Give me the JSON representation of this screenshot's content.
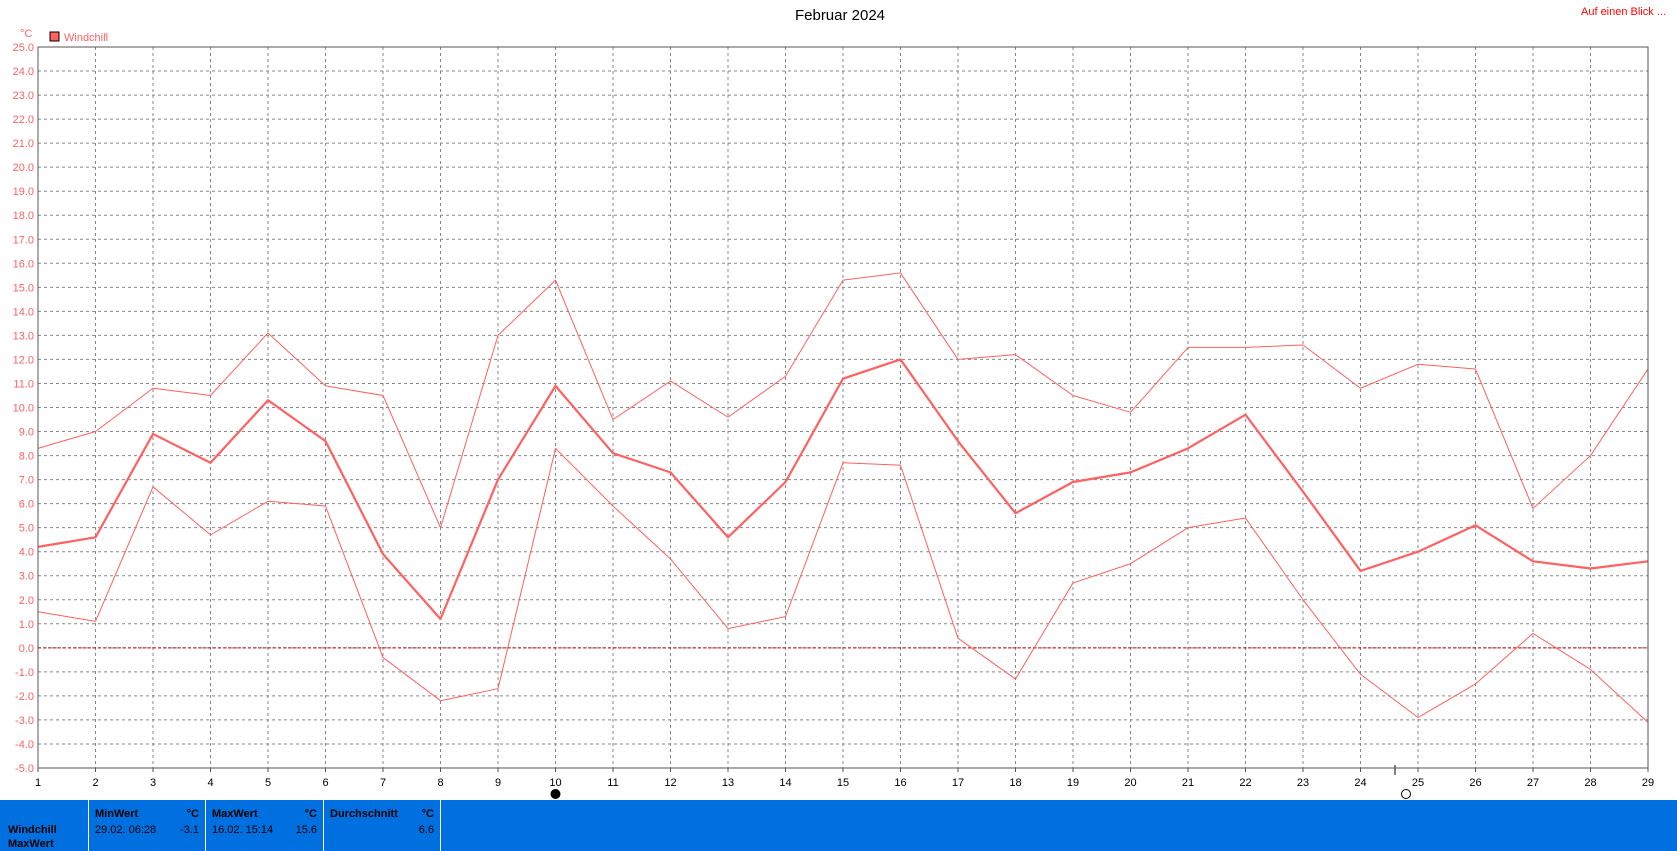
{
  "header": {
    "title": "Februar 2024",
    "link_label": "Auf einen Blick ..."
  },
  "colors": {
    "series": "#ff6060",
    "zero_line": "#cc0000",
    "footer_bg": "#0070e0"
  },
  "chart_data": {
    "type": "line",
    "title": "Februar 2024",
    "ylabel": "°C",
    "ylim": [
      -5,
      25
    ],
    "ytick_step": 1,
    "grid": true,
    "legend_placement": "top-left",
    "legend": [
      "Windchill"
    ],
    "x": [
      1,
      2,
      3,
      4,
      5,
      6,
      7,
      8,
      9,
      10,
      11,
      12,
      13,
      14,
      15,
      16,
      17,
      18,
      19,
      20,
      21,
      22,
      23,
      24,
      25,
      26,
      27,
      28,
      29
    ],
    "series": [
      {
        "name": "Windchill",
        "role": "avg",
        "values": [
          4.2,
          4.6,
          8.9,
          7.7,
          10.3,
          8.6,
          3.9,
          1.2,
          7.0,
          10.9,
          8.1,
          7.3,
          4.6,
          6.9,
          11.2,
          12.0,
          8.6,
          5.6,
          6.9,
          7.3,
          8.3,
          9.7,
          6.5,
          3.2,
          4.0,
          5.1,
          3.6,
          3.3,
          3.6
        ]
      },
      {
        "role": "max",
        "values": [
          8.3,
          9.0,
          10.8,
          10.5,
          13.1,
          10.9,
          10.5,
          5.0,
          13.0,
          15.3,
          9.5,
          11.1,
          9.6,
          11.3,
          15.3,
          15.6,
          12.0,
          12.2,
          10.5,
          9.8,
          12.5,
          12.5,
          12.6,
          10.8,
          11.8,
          11.6,
          5.8,
          8.0,
          11.6
        ]
      },
      {
        "role": "min",
        "values": [
          1.5,
          1.1,
          6.7,
          4.7,
          6.1,
          5.9,
          -0.4,
          -2.2,
          -1.7,
          8.3,
          5.9,
          3.7,
          0.8,
          1.3,
          7.7,
          7.6,
          0.4,
          -1.3,
          2.7,
          3.5,
          5.0,
          5.4,
          2.0,
          -1.1,
          -2.9,
          -1.5,
          0.6,
          -0.9,
          -3.1
        ]
      }
    ],
    "markers": [
      {
        "x": 10,
        "type": "full-moon"
      },
      {
        "x": 24.6,
        "type": "new-moon"
      }
    ]
  },
  "footer": {
    "row_labels": [
      "Windchill",
      "MaxWert"
    ],
    "min_header": "MinWert",
    "min_unit": "°C",
    "min_date": "29.02.  06:28",
    "min_value": "-3.1",
    "max_header": "MaxWert",
    "max_unit": "°C",
    "max_date": "16.02.  15:14",
    "max_value": "15.6",
    "avg_header": "Durchschnitt",
    "avg_unit": "°C",
    "avg_value": "6.6"
  }
}
